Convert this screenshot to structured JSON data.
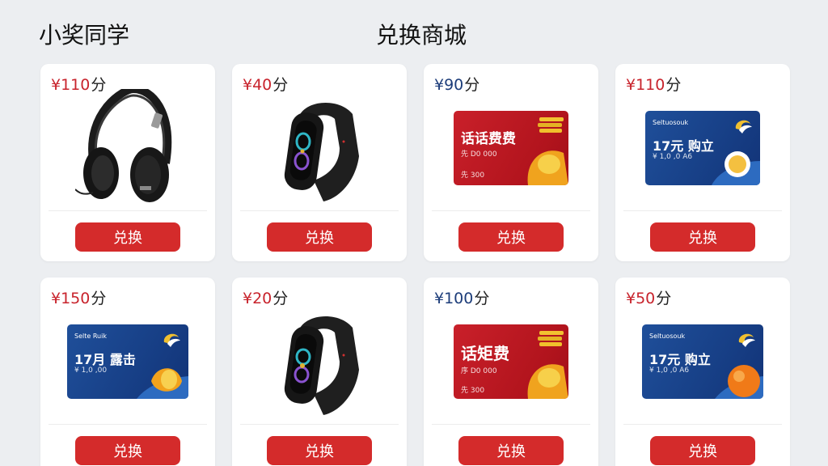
{
  "header": {
    "user_name": "小奖同学",
    "title": "兑换商城"
  },
  "products": [
    {
      "price": "¥110",
      "unit": "分",
      "image": "headphones",
      "button": "兑换"
    },
    {
      "price": "¥40",
      "unit": "分",
      "image": "fitness-band",
      "button": "兑换"
    },
    {
      "price": "¥90",
      "unit": "分",
      "image": "red-phone-card",
      "button": "兑换",
      "card": {
        "title": "话话费费",
        "line1": "先 D0 000",
        "line2": "先 300"
      }
    },
    {
      "price": "¥110",
      "unit": "分",
      "image": "blue-voucher-card",
      "button": "兑换",
      "card": {
        "top": "Seltuosouk",
        "title": "17元 购立",
        "line1": "¥ 1,0 ,0 A6"
      }
    },
    {
      "price": "¥150",
      "unit": "分",
      "image": "blue-voucher-card",
      "button": "兑换",
      "card": {
        "top": "Selte Ruik",
        "title": "17月 露击",
        "line1": "¥ 1,0 ,00"
      }
    },
    {
      "price": "¥20",
      "unit": "分",
      "image": "fitness-band",
      "button": "兑换"
    },
    {
      "price": "¥100",
      "unit": "分",
      "image": "red-phone-card",
      "button": "兑换",
      "card": {
        "title": "话矩费",
        "line1": "序 D0 000",
        "line2": "先 300"
      }
    },
    {
      "price": "¥50",
      "unit": "分",
      "image": "blue-voucher-card",
      "button": "兑换",
      "card": {
        "top": "Seltuosouk",
        "title": "17元 购立",
        "line1": "¥ 1,0 ,0 A6"
      }
    }
  ],
  "colors": {
    "accent": "#d42b2b",
    "price_red": "#c8232c",
    "price_blue": "#1d3d7a"
  }
}
